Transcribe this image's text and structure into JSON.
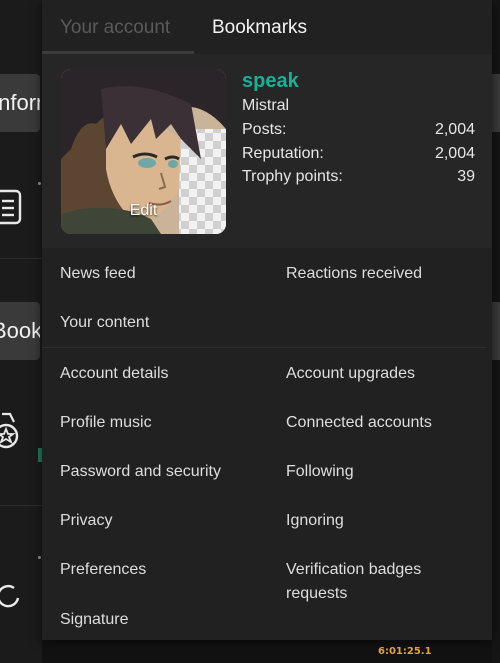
{
  "background": {
    "pill_1": "Inform",
    "pill_2": "Books"
  },
  "tabs": [
    {
      "label": "Your account",
      "active": false
    },
    {
      "label": "Bookmarks",
      "active": true
    }
  ],
  "profile": {
    "avatar_edit": "Edit",
    "username": "speak",
    "user_title": "Mistral",
    "stats": [
      {
        "label": "Posts:",
        "value": "2,004"
      },
      {
        "label": "Reputation:",
        "value": "2,004"
      },
      {
        "label": "Trophy points:",
        "value": "39"
      }
    ]
  },
  "links": {
    "news_feed": "News feed",
    "reactions_received": "Reactions received",
    "your_content": "Your content",
    "account_details": "Account details",
    "account_upgrades": "Account upgrades",
    "profile_music": "Profile music",
    "connected_accounts": "Connected accounts",
    "password_security": "Password and security",
    "following": "Following",
    "privacy": "Privacy",
    "ignoring": "Ignoring",
    "preferences": "Preferences",
    "verification_badges_line1": "Verification badges",
    "verification_badges_line2": "requests",
    "signature": "Signature"
  },
  "status": {
    "clock": "6:01:25.1"
  },
  "colors": {
    "accent": "#1eae95",
    "panel": "#212121",
    "profile_bg": "#262626"
  }
}
